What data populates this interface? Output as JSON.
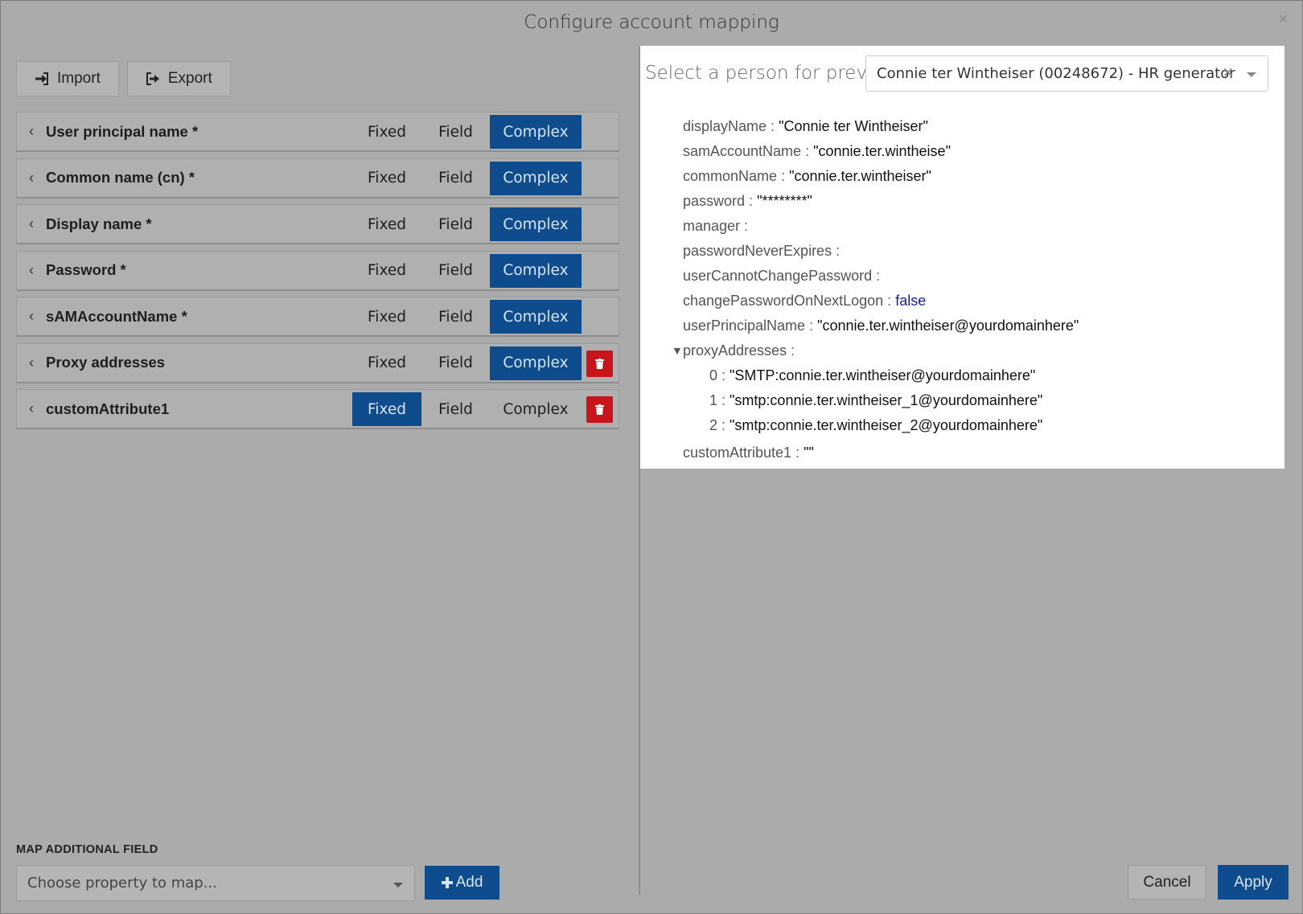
{
  "dialog": {
    "title": "Configure account mapping",
    "close_glyph": "×"
  },
  "toolbar": {
    "import_label": "Import",
    "export_label": "Export"
  },
  "mode_labels": {
    "fixed": "Fixed",
    "field": "Field",
    "complex": "Complex"
  },
  "mappings": [
    {
      "label": "User principal name *",
      "mode": "complex",
      "deletable": false
    },
    {
      "label": "Common name (cn) *",
      "mode": "complex",
      "deletable": false
    },
    {
      "label": "Display name *",
      "mode": "complex",
      "deletable": false
    },
    {
      "label": "Password *",
      "mode": "complex",
      "deletable": false
    },
    {
      "label": "sAMAccountName *",
      "mode": "complex",
      "deletable": false
    },
    {
      "label": "Proxy addresses",
      "mode": "complex",
      "deletable": true
    },
    {
      "label": "customAttribute1",
      "mode": "fixed",
      "deletable": true
    }
  ],
  "preview": {
    "label": "Select a person for preview",
    "selected_person": "Connie ter Wintheiser (00248672) - HR generator",
    "fields": [
      {
        "key": "displayName",
        "value": "\"Connie ter Wintheiser\"",
        "type": "string"
      },
      {
        "key": "samAccountName",
        "value": "\"connie.ter.wintheise\"",
        "type": "string"
      },
      {
        "key": "commonName",
        "value": "\"connie.ter.wintheiser\"",
        "type": "string"
      },
      {
        "key": "password",
        "value": "\"********\"",
        "type": "string"
      },
      {
        "key": "manager",
        "value": "",
        "type": "empty"
      },
      {
        "key": "passwordNeverExpires",
        "value": "",
        "type": "empty"
      },
      {
        "key": "userCannotChangePassword",
        "value": "",
        "type": "empty"
      },
      {
        "key": "changePasswordOnNextLogon",
        "value": "false",
        "type": "bool"
      },
      {
        "key": "userPrincipalName",
        "value": "\"connie.ter.wintheiser@yourdomainhere\"",
        "type": "string"
      }
    ],
    "proxy": {
      "key": "proxyAddresses",
      "items": [
        {
          "index": "0",
          "value": "\"SMTP:connie.ter.wintheiser@yourdomainhere\""
        },
        {
          "index": "1",
          "value": "\"smtp:connie.ter.wintheiser_1@yourdomainhere\""
        },
        {
          "index": "2",
          "value": "\"smtp:connie.ter.wintheiser_2@yourdomainhere\""
        }
      ]
    },
    "last_field": {
      "key": "customAttribute1",
      "value": "\"\""
    }
  },
  "map_additional": {
    "label": "MAP ADDITIONAL FIELD",
    "placeholder": "Choose property to map...",
    "add_label": "Add"
  },
  "footer": {
    "cancel_label": "Cancel",
    "apply_label": "Apply"
  },
  "colors": {
    "accent": "#0f4c8d",
    "danger": "#c8151b",
    "bool": "#1a1aa6"
  }
}
